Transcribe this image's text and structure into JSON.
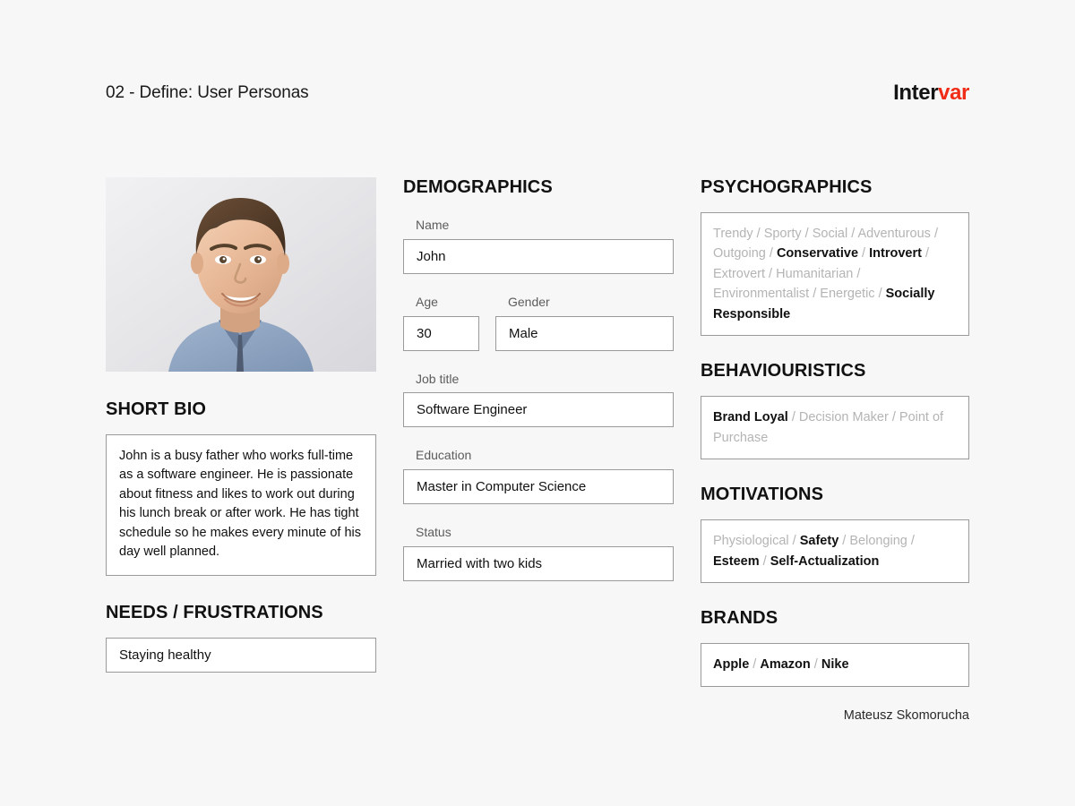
{
  "header": {
    "deck_title": "02 - Define: User Personas",
    "logo_part_one": "Inter",
    "logo_part_two": "var",
    "logo_color_one": "#141414",
    "logo_color_two": "#f02c17"
  },
  "left": {
    "photo_alt": "persona-headshot-photo",
    "short_bio_title": "SHORT BIO",
    "short_bio_text": "John is a busy father who works full-time as a software engineer. He is passionate about fitness and likes to work out during his lunch break or after work. He has tight schedule so he makes every minute of his day well planned.",
    "needs_title": "NEEDS / FRUSTRATIONS",
    "needs_value": "Staying healthy"
  },
  "demographics": {
    "title": "DEMOGRAPHICS",
    "name_label": "Name",
    "name_value": "John",
    "age_label": "Age",
    "age_value": "30",
    "gender_label": "Gender",
    "gender_value": "Male",
    "job_title_label": "Job title",
    "job_title_value": "Software Engineer",
    "education_label": "Education",
    "education_value": "Master in Computer Science",
    "status_label": "Status",
    "status_value": "Married with two kids"
  },
  "psychographics": {
    "title": "PSYCHOGRAPHICS",
    "items": [
      {
        "label": "Trendy",
        "selected": false
      },
      {
        "label": "Sporty",
        "selected": false
      },
      {
        "label": "Social",
        "selected": false
      },
      {
        "label": "Adventurous",
        "selected": false
      },
      {
        "label": "Outgoing",
        "selected": false
      },
      {
        "label": "Conservative",
        "selected": true
      },
      {
        "label": "Introvert",
        "selected": true
      },
      {
        "label": "Extrovert",
        "selected": false
      },
      {
        "label": "Humanitarian",
        "selected": false
      },
      {
        "label": "Environmentalist",
        "selected": false
      },
      {
        "label": "Energetic",
        "selected": false
      },
      {
        "label": "Socially Responsible",
        "selected": true
      }
    ]
  },
  "behaviouristics": {
    "title": "BEHAVIOURISTICS",
    "items": [
      {
        "label": "Brand Loyal",
        "selected": true
      },
      {
        "label": "Decision Maker",
        "selected": false
      },
      {
        "label": "Point of Purchase",
        "selected": false
      }
    ]
  },
  "motivations": {
    "title": "MOTIVATIONS",
    "items": [
      {
        "label": "Physiological",
        "selected": false
      },
      {
        "label": "Safety",
        "selected": true
      },
      {
        "label": "Belonging",
        "selected": false
      },
      {
        "label": "Esteem",
        "selected": true
      },
      {
        "label": "Self-Actualization",
        "selected": true
      }
    ]
  },
  "brands": {
    "title": "BRANDS",
    "items": [
      {
        "label": "Apple",
        "selected": true
      },
      {
        "label": "Amazon",
        "selected": true
      },
      {
        "label": "Nike",
        "selected": true
      }
    ]
  },
  "footer": {
    "author": "Mateusz Skomorucha"
  },
  "colors": {
    "page_background": "#f7f7f7",
    "box_background": "#ffffff",
    "box_border": "#9a9a9a",
    "text_primary": "#111111",
    "label_grey": "#5c5c5c",
    "tag_inactive_grey": "#b4b4b4",
    "accent_red": "#f02c17"
  }
}
